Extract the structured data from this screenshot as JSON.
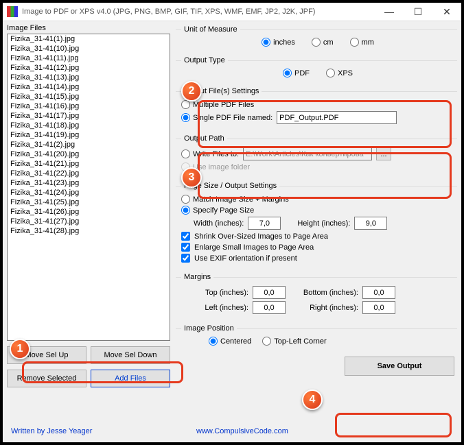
{
  "window": {
    "title": "Image to PDF or XPS  v4.0   (JPG, PNG, BMP, GIF, TIF, XPS, WMF, EMF, JP2, J2K, JPF)"
  },
  "left": {
    "title": "Image Files",
    "files": [
      "Fizika_31-41(1).jpg",
      "Fizika_31-41(10).jpg",
      "Fizika_31-41(11).jpg",
      "Fizika_31-41(12).jpg",
      "Fizika_31-41(13).jpg",
      "Fizika_31-41(14).jpg",
      "Fizika_31-41(15).jpg",
      "Fizika_31-41(16).jpg",
      "Fizika_31-41(17).jpg",
      "Fizika_31-41(18).jpg",
      "Fizika_31-41(19).jpg",
      "Fizika_31-41(2).jpg",
      "Fizika_31-41(20).jpg",
      "Fizika_31-41(21).jpg",
      "Fizika_31-41(22).jpg",
      "Fizika_31-41(23).jpg",
      "Fizika_31-41(24).jpg",
      "Fizika_31-41(25).jpg",
      "Fizika_31-41(26).jpg",
      "Fizika_31-41(27).jpg",
      "Fizika_31-41(28).jpg"
    ],
    "move_up": "Move Sel Up",
    "move_down": "Move Sel Down",
    "remove": "Remove Selected",
    "add": "Add Files"
  },
  "unit": {
    "legend": "Unit of Measure",
    "inches": "inches",
    "cm": "cm",
    "mm": "mm"
  },
  "outtype": {
    "legend": "Output Type",
    "pdf": "PDF",
    "xps": "XPS"
  },
  "outfile": {
    "legend": "Output File(s) Settings",
    "multiple": "Multiple PDF Files",
    "single": "Single PDF File named:",
    "filename": "PDF_Output.PDF"
  },
  "outpath": {
    "legend": "Output Path",
    "write": "Write Files to:",
    "path": "E:\\Work\\Articles\\Как конвертирова",
    "use_img": "Use image folder",
    "browse": "..."
  },
  "page": {
    "legend": "Page Size / Output Settings",
    "match": "Match Image Size + Margins",
    "specify": "Specify Page Size",
    "width_lbl": "Width (inches):",
    "width": "7,0",
    "height_lbl": "Height (inches):",
    "height": "9,0",
    "shrink": "Shrink Over-Sized Images to Page Area",
    "enlarge": "Enlarge Small Images to Page Area",
    "exif": "Use EXIF orientation if present"
  },
  "margins": {
    "legend": "Margins",
    "top_lbl": "Top (inches):",
    "top": "0,0",
    "bottom_lbl": "Bottom (inches):",
    "bottom": "0,0",
    "left_lbl": "Left (inches):",
    "left": "0,0",
    "right_lbl": "Right (inches):",
    "right": "0,0"
  },
  "position": {
    "legend": "Image Position",
    "center": "Centered",
    "topleft": "Top-Left Corner"
  },
  "save": "Save Output",
  "credit1": "Written by Jesse Yeager",
  "credit2": "www.CompulsiveCode.com"
}
